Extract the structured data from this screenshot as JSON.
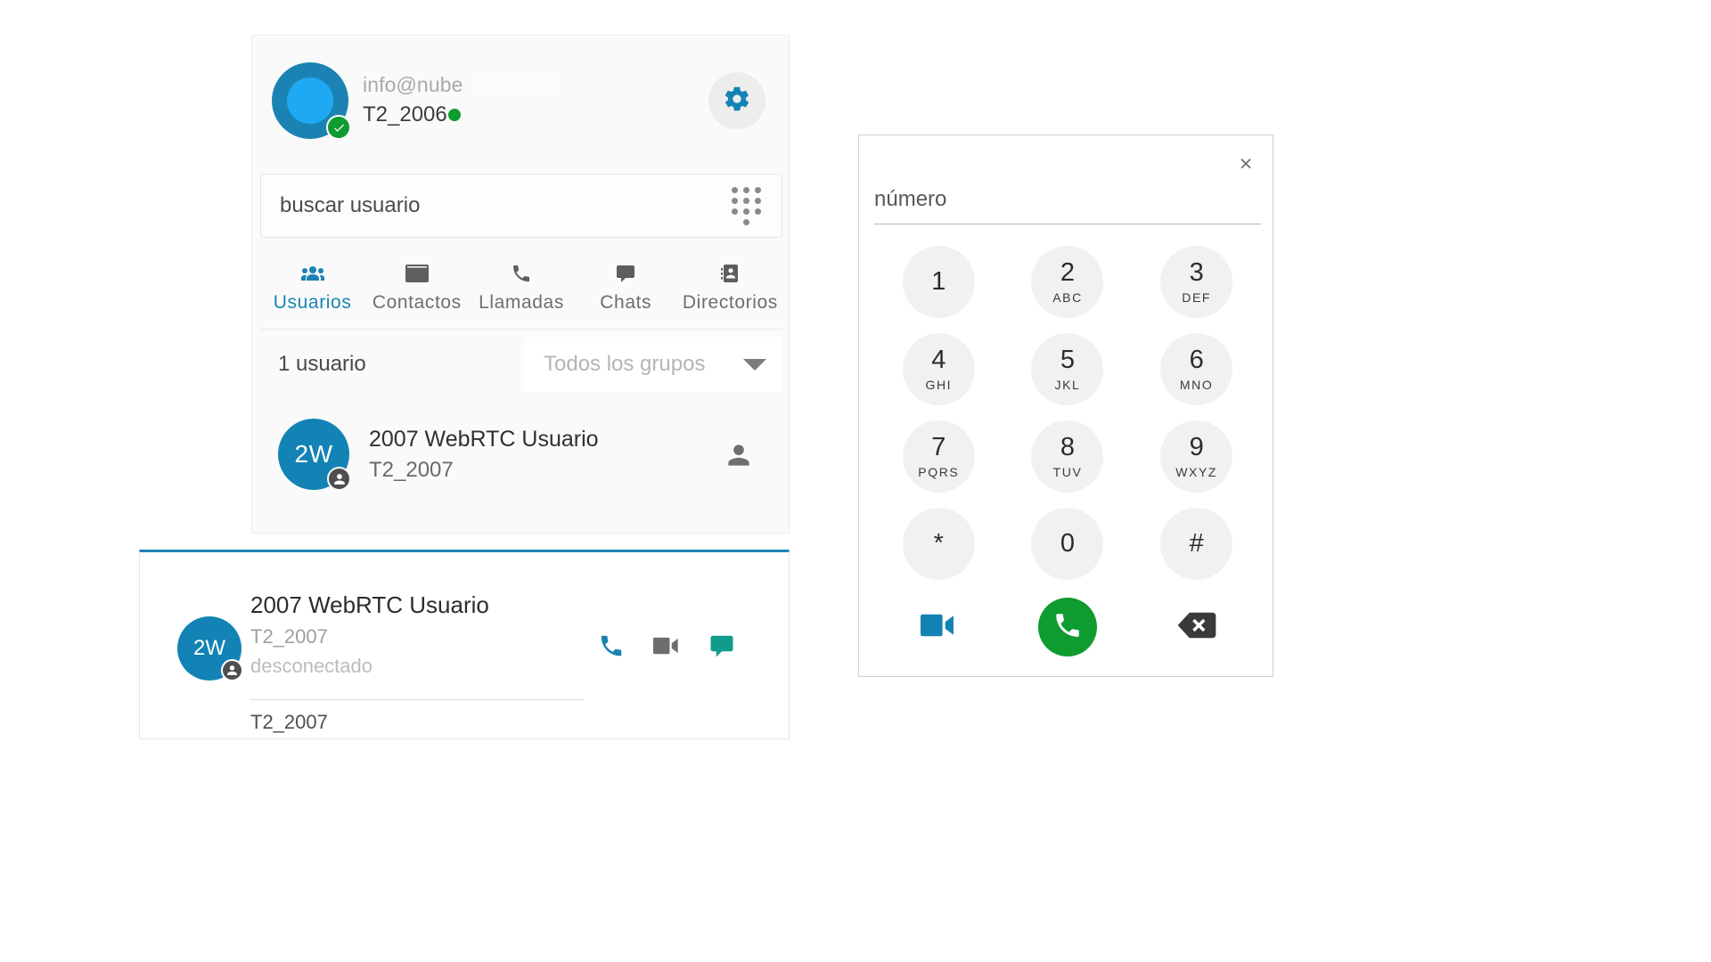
{
  "profile": {
    "email": "info@nube",
    "extension": "T2_2006",
    "status": "online",
    "verified_icon": "check-badge-icon",
    "avatar_icon": "user-avatar-ring",
    "settings_icon": "gear-icon"
  },
  "search": {
    "placeholder": "buscar usuario",
    "value": "",
    "dialpad_icon": "dialpad-dots-icon"
  },
  "tabs": [
    {
      "label": "Usuarios",
      "icon": "users-group-icon",
      "active": true
    },
    {
      "label": "Contactos",
      "icon": "contact-card-icon",
      "active": false
    },
    {
      "label": "Llamadas",
      "icon": "phone-icon",
      "active": false
    },
    {
      "label": "Chats",
      "icon": "chat-bubble-icon",
      "active": false
    },
    {
      "label": "Directorios",
      "icon": "address-book-icon",
      "active": false
    }
  ],
  "list_header": {
    "count_label": "1 usuario",
    "group_filter_label": "Todos los grupos",
    "caret_icon": "chevron-down-icon"
  },
  "user_row": {
    "initials": "2W",
    "name": "2007 WebRTC Usuario",
    "extension": "T2_2007",
    "presence_icon": "person-offline-icon",
    "trailing_icon": "person-icon"
  },
  "contact_card": {
    "initials": "2W",
    "name": "2007 WebRTC Usuario",
    "extension": "T2_2007",
    "status": "desconectado",
    "extension_detail": "T2_2007",
    "actions": [
      {
        "name": "call-audio",
        "icon": "phone-icon",
        "color": "#1b83b4"
      },
      {
        "name": "call-video",
        "icon": "video-camera-icon",
        "color": "#6e6e6e"
      },
      {
        "name": "open-chat",
        "icon": "chat-bubble-icon",
        "color": "#0f9c8a"
      }
    ]
  },
  "dialpad": {
    "close_label": "×",
    "number_placeholder": "número",
    "number_value": "",
    "keys": [
      {
        "digit": "1",
        "letters": ""
      },
      {
        "digit": "2",
        "letters": "ABC"
      },
      {
        "digit": "3",
        "letters": "DEF"
      },
      {
        "digit": "4",
        "letters": "GHI"
      },
      {
        "digit": "5",
        "letters": "JKL"
      },
      {
        "digit": "6",
        "letters": "MNO"
      },
      {
        "digit": "7",
        "letters": "PQRS"
      },
      {
        "digit": "8",
        "letters": "TUV"
      },
      {
        "digit": "9",
        "letters": "WXYZ"
      },
      {
        "digit": "*",
        "letters": ""
      },
      {
        "digit": "0",
        "letters": ""
      },
      {
        "digit": "#",
        "letters": ""
      }
    ],
    "video_icon": "video-camera-icon",
    "call_icon": "phone-icon",
    "backspace_icon": "backspace-icon"
  },
  "colors": {
    "accent": "#1b83b4",
    "avatar": "#1283b4",
    "online": "#0e9b2f",
    "call_green": "#0e9b2f",
    "video_blue": "#1283b4",
    "chat_teal": "#0f9c8a",
    "key_bg": "#f1f1f1"
  }
}
